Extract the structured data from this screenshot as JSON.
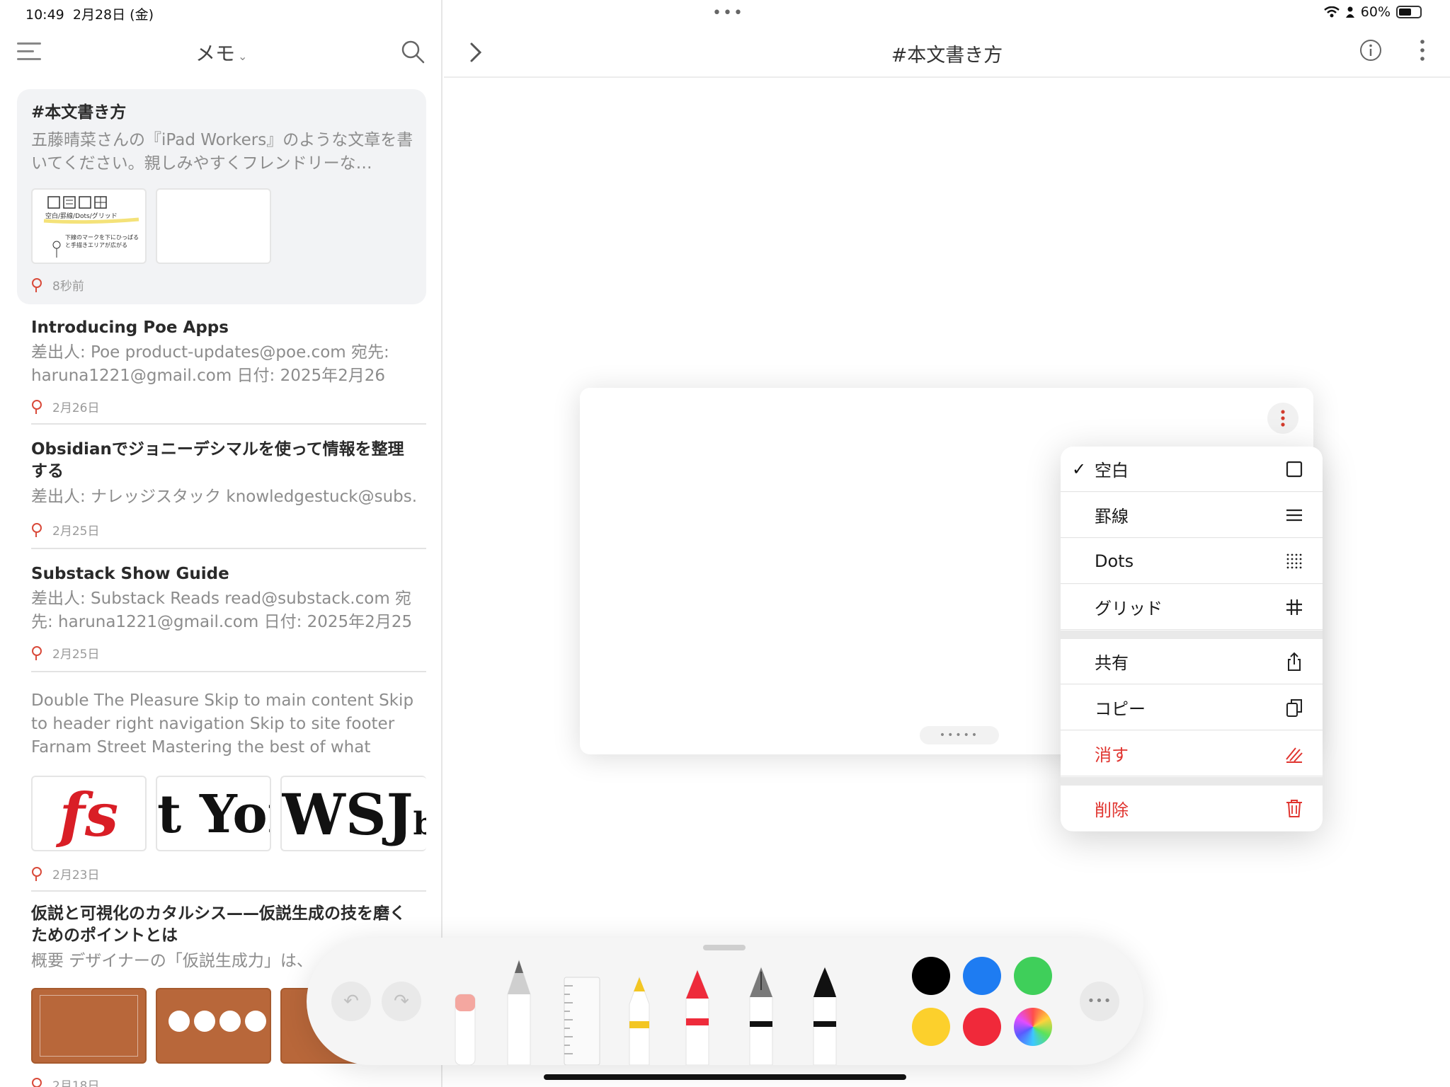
{
  "status_bar": {
    "time": "10:49",
    "date": "2月28日 (金)",
    "battery": "60%",
    "battery_level": 0.6
  },
  "sidebar": {
    "title": "メモ",
    "notes": [
      {
        "title": "#本文書き方",
        "preview": "五藤晴菜さんの『iPad Workers』のような文章を書いてください。親しみやすくフレンドリーな…",
        "thumb_caption_1": "空白/罫線/Dots/グリッド",
        "thumb_caption_2": "下線のマークを下にひっぱると手描きエリアが広がる",
        "time": "8秒前"
      },
      {
        "title": "Introducing Poe Apps",
        "preview": "差出人: Poe product-updates@poe.com 宛先: haruna1221@gmail.com 日付: 2025年2月26日…",
        "time": "2月26日"
      },
      {
        "title": "Obsidianでジョニーデシマルを使って情報を整理する",
        "preview": "差出人: ナレッジスタック knowledgestuck@subs...",
        "time": "2月25日"
      },
      {
        "title": "Substack Show Guide",
        "preview": "差出人: Substack Reads read@substack.com 宛先: haruna1221@gmail.com 日付: 2025年2月25日…",
        "time": "2月25日"
      },
      {
        "title": "",
        "preview": "Double The Pleasure Skip to main content Skip to header right navigation Skip to site footer Farnam Street Mastering the best of what other...",
        "logos": [
          "fs",
          "t Yor",
          "WSJ",
          "b"
        ],
        "time": "2月23日"
      },
      {
        "title": "仮説と可視化のカタルシス——仮説生成の技を磨くためのポイントとは",
        "preview": "概要 デザイナーの「仮説生成力」は、",
        "time": "2月18日"
      }
    ]
  },
  "editor": {
    "title": "#本文書き方"
  },
  "context_menu": {
    "items": [
      {
        "label": "空白",
        "icon": "square-icon",
        "checked": true
      },
      {
        "label": "罫線",
        "icon": "lines-icon"
      },
      {
        "label": "Dots",
        "icon": "dots-grid-icon"
      },
      {
        "label": "グリッド",
        "icon": "hash-icon"
      },
      {
        "label": "共有",
        "icon": "share-icon"
      },
      {
        "label": "コピー",
        "icon": "copy-icon"
      },
      {
        "label": "消す",
        "icon": "eraser-icon",
        "destructive": true
      },
      {
        "label": "削除",
        "icon": "trash-icon",
        "destructive": true
      }
    ],
    "check_mark": "✓"
  },
  "toolbar": {
    "tools": [
      "eraser",
      "pencil",
      "ruler",
      "highlighter-yellow",
      "marker-red",
      "fountain-pen",
      "brush-pen"
    ],
    "colors": [
      "#000000",
      "#1e7cf2",
      "#3fcf5a",
      "#fcd02c",
      "#f0293a",
      "color-wheel"
    ]
  }
}
